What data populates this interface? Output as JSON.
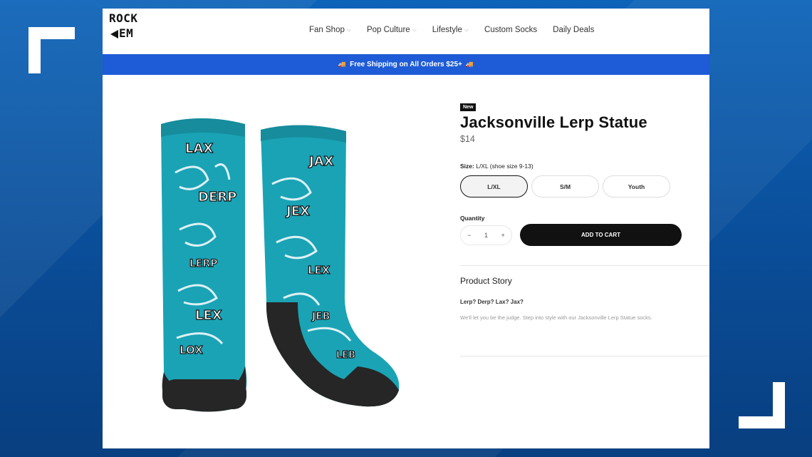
{
  "logo": {
    "line1": "ROCK",
    "line2": "EM"
  },
  "nav": [
    {
      "label": "Fan Shop",
      "dropdown": true
    },
    {
      "label": "Pop Culture",
      "dropdown": true
    },
    {
      "label": "Lifestyle",
      "dropdown": true
    },
    {
      "label": "Custom Socks",
      "dropdown": false
    },
    {
      "label": "Daily Deals",
      "dropdown": false
    }
  ],
  "banner": {
    "text": "Free Shipping on All Orders $25+",
    "icon": "truck-icon"
  },
  "product": {
    "badge": "New",
    "title": "Jacksonville Lerp Statue",
    "price": "$14",
    "size_label": "Size:",
    "size_value": "L/XL (shoe size 9-13)",
    "sizes": [
      "L/XL",
      "S/M",
      "Youth"
    ],
    "selected_size": "L/XL",
    "quantity_label": "Quantity",
    "quantity": "1",
    "minus": "−",
    "plus": "+",
    "add_to_cart": "ADD TO CART",
    "story_title": "Product Story",
    "story_question": "Lerp? Derp? Lax? Jax?",
    "story_text": "We'll let you be the judge. Step into style with our Jacksonville Lerp Statue socks."
  },
  "sock_words": {
    "left": [
      "LAX",
      "DERP",
      "LERP",
      "LEX",
      "LOX"
    ],
    "right": [
      "JAX",
      "JEX",
      "LEX",
      "JEB",
      "LEB"
    ]
  },
  "colors": {
    "banner": "#1e5bd6",
    "sock_teal": "#1aa3b5",
    "sock_dark": "#222222",
    "background": "#0a4f9c"
  }
}
